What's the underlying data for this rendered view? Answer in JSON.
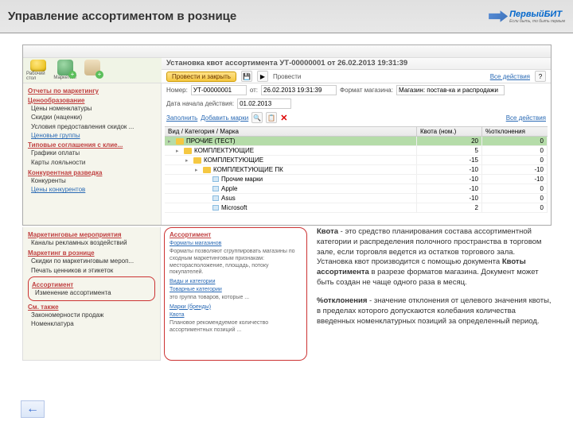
{
  "slide_title": "Управление ассортиментом в рознице",
  "logo": {
    "text": "ПервыйБИТ",
    "sub": "Если быть, то быть первым"
  },
  "doc": {
    "title": "Установка квот ассортимента УТ-00000001 от 26.02.2013 19:31:39",
    "post_close": "Провести и закрыть",
    "post": "Провести",
    "all_actions": "Все действия",
    "num_lbl": "Номер:",
    "num_val": "УТ-00000001",
    "from_lbl": "от:",
    "from_val": "26.02.2013 19:31:39",
    "fmt_lbl": "Формат магазина:",
    "fmt_val": "Магазин: постав-ка и распродажи",
    "start_lbl": "Дата начала действия:",
    "start_val": "01.02.2013",
    "fill_lbl": "Заполнить",
    "add_brands": "Добавить марки",
    "cols": {
      "cat": "Вид / Категория / Марка",
      "quota": "Квота (ном.)",
      "dev": "%отклонения"
    },
    "rows": [
      {
        "level": 0,
        "type": "folder",
        "label": "ПРОЧИЕ (ТЕСТ)",
        "quota": "20",
        "dev": "0",
        "selected": true
      },
      {
        "level": 1,
        "type": "folder",
        "label": "КОМПЛЕКТУЮЩИЕ",
        "quota": "5",
        "dev": "0"
      },
      {
        "level": 2,
        "type": "folder",
        "label": "КОМПЛЕКТУЮЩИЕ",
        "quota": "-15",
        "dev": "0"
      },
      {
        "level": 3,
        "type": "folder",
        "label": "КОМПЛЕКТУЮЩИЕ ПК",
        "quota": "-10",
        "dev": "-10"
      },
      {
        "level": 4,
        "type": "item",
        "label": "Прочие марки",
        "quota": "-10",
        "dev": "-10"
      },
      {
        "level": 4,
        "type": "item",
        "label": "Apple",
        "quota": "-10",
        "dev": "0"
      },
      {
        "level": 4,
        "type": "item",
        "label": "Asus",
        "quota": "-10",
        "dev": "0"
      },
      {
        "level": 4,
        "type": "item",
        "label": "Microsoft",
        "quota": "2",
        "dev": "0"
      }
    ]
  },
  "sidebar": {
    "g1": "Отчеты по маркетингу",
    "g2": "Ценообразование",
    "g2i": [
      "Цены номенклатуры",
      "Скидки (наценки)",
      "Условия предоставления скидок ..."
    ],
    "more": "Ценовые группы",
    "g3": "Типовые соглашения с клие...",
    "g3i": [
      "Графики оплаты",
      "Карты лояльности"
    ],
    "g4": "Конкурентная разведка",
    "g4i": [
      "Конкуренты"
    ],
    "g5_more": "Цены конкурентов"
  },
  "sidebar_ext": {
    "g5": "Маркетинговые мероприятия",
    "g5i": [
      "Каналы рекламных воздействий"
    ],
    "g6": "Маркетинг в рознице",
    "g6i": [
      "Скидки по маркетинговым мероп...",
      "Печать ценников и этикеток"
    ],
    "g7": "Ассортимент",
    "g7i": [
      "Изменение ассортимента"
    ],
    "g8": "См. также",
    "g8i": [
      "Закономерности продаж",
      "Номенклатура"
    ]
  },
  "assort": {
    "title": "Ассортимент",
    "l1": "Форматы магазинов",
    "t1": "Форматы позволяют сгруппировать магазины по сходным маркетинговым признакам: месторасположение, площадь, потоку покупателей.",
    "l2": "Виды и категории",
    "l3": "Товарные категории",
    "t3": "это группа товаров, которые ...",
    "l4": "Марки (бренды)",
    "l5": "Квота",
    "t5": "Плановое рекомендуемое количество ассортиментных позиций ..."
  },
  "defs": {
    "p1a": "Квота",
    "p1b": " - это средство планирования состава ассортиментной категории и распределения полочного пространства в торговом зале, если торговля ведется из остатков торгового зала. Установка квот производится с помощью документа ",
    "p1c": "Квоты ассортимента",
    "p1d": " в разрезе форматов магазина. Документ может быть создан не чаще одного раза в месяц.",
    "p2a": "%отклонения",
    "p2b": " - значение отклонения от целевого значения квоты, в пределах которого допускаются колебания количества введенных номенклатурных позиций за определенный период."
  }
}
